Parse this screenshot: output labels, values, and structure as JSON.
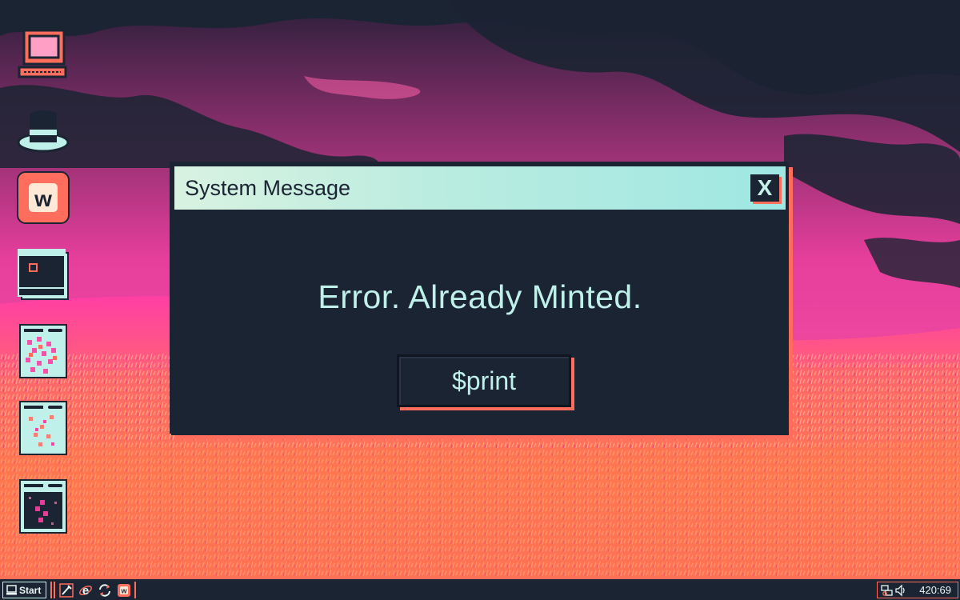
{
  "colors": {
    "navy": "#1b2433",
    "pink": "#ff3fa4",
    "coral": "#ff6d5c",
    "mint": "#bff0ea"
  },
  "desktop": {
    "icons": [
      {
        "name": "computer-icon"
      },
      {
        "name": "top-hat-icon"
      },
      {
        "name": "w-app-icon",
        "glyph": "w"
      },
      {
        "name": "calendar-icon"
      },
      {
        "name": "fingerprint-card-1-icon"
      },
      {
        "name": "fingerprint-card-2-icon"
      },
      {
        "name": "fingerprint-card-3-icon"
      }
    ]
  },
  "dialog": {
    "title": "System Message",
    "close_label": "X",
    "message": "Error. Already Minted.",
    "button_label": "$print"
  },
  "taskbar": {
    "start_label": "Start",
    "quick_launch": [
      {
        "name": "pen-icon"
      },
      {
        "name": "browser-e-icon",
        "glyph": "e"
      },
      {
        "name": "refresh-icon"
      },
      {
        "name": "w-app-icon",
        "glyph": "w"
      }
    ],
    "tray_icons": [
      {
        "name": "network-icon"
      },
      {
        "name": "volume-icon"
      }
    ],
    "clock": "420:69"
  }
}
